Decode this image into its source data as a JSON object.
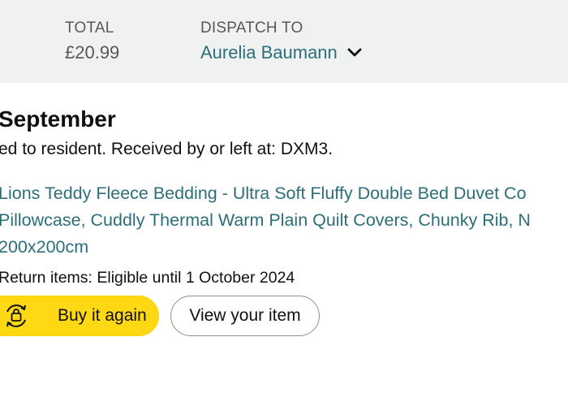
{
  "header": {
    "total_label": "TOTAL",
    "total_value": "£20.99",
    "dispatch_label": "DISPATCH TO",
    "dispatch_value": "Aurelia Baumann",
    "dispatch_icon": "chevron-down-icon"
  },
  "shipment": {
    "status_title": "September",
    "status_detail": "ed to resident. Received by or left at: DXM3."
  },
  "product": {
    "title_lines": [
      "Lions Teddy Fleece Bedding - Ultra Soft Fluffy Double Bed Duvet Co",
      "Pillowcase, Cuddly Thermal Warm Plain Quilt Covers, Chunky Rib, N",
      "200x200cm"
    ],
    "return_info": "Return items: Eligible until 1 October 2024"
  },
  "actions": {
    "buy_again_label": "Buy it again",
    "buy_again_icon": "buy-again-icon",
    "view_item_label": "View your item"
  },
  "colors": {
    "header_bg": "#f0f2f2",
    "link": "#2c6e7a",
    "buy_button": "#ffd814"
  }
}
